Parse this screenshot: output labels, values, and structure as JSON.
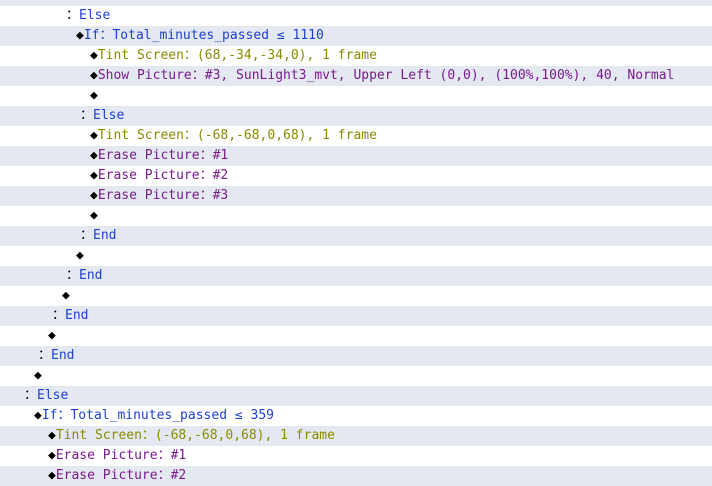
{
  "colors": {
    "row_alt": "#e4e9f1",
    "keyword": "#1f3fd1",
    "tint_screen": "#8a8a00",
    "picture": "#7a1a8f",
    "marker": "#000000"
  },
  "symbols": {
    "diamond": "◆",
    "colon": "："
  },
  "lines": [
    {
      "indent": 80,
      "kind": "diamond",
      "text": ""
    },
    {
      "indent": 66,
      "kind": "branch",
      "text": "Else"
    },
    {
      "indent": 76,
      "kind": "if",
      "text": "If：Total_minutes_passed ≤ 1110"
    },
    {
      "indent": 90,
      "kind": "tint",
      "text": "Tint Screen：(68,-34,-34,0), 1 frame"
    },
    {
      "indent": 90,
      "kind": "pic",
      "text": "Show Picture：#3, SunLight3_mvt, Upper Left (0,0), (100%,100%), 40, Normal"
    },
    {
      "indent": 90,
      "kind": "diamond",
      "text": ""
    },
    {
      "indent": 80,
      "kind": "branch",
      "text": "Else"
    },
    {
      "indent": 90,
      "kind": "tint",
      "text": "Tint Screen：(-68,-68,0,68), 1 frame"
    },
    {
      "indent": 90,
      "kind": "pic",
      "text": "Erase Picture：#1"
    },
    {
      "indent": 90,
      "kind": "pic",
      "text": "Erase Picture：#2"
    },
    {
      "indent": 90,
      "kind": "pic",
      "text": "Erase Picture：#3"
    },
    {
      "indent": 90,
      "kind": "diamond",
      "text": ""
    },
    {
      "indent": 80,
      "kind": "branch",
      "text": "End"
    },
    {
      "indent": 76,
      "kind": "diamond",
      "text": ""
    },
    {
      "indent": 66,
      "kind": "branch",
      "text": "End"
    },
    {
      "indent": 62,
      "kind": "diamond",
      "text": ""
    },
    {
      "indent": 52,
      "kind": "branch",
      "text": "End"
    },
    {
      "indent": 48,
      "kind": "diamond",
      "text": ""
    },
    {
      "indent": 38,
      "kind": "branch",
      "text": "End"
    },
    {
      "indent": 34,
      "kind": "diamond",
      "text": ""
    },
    {
      "indent": 24,
      "kind": "branch",
      "text": "Else"
    },
    {
      "indent": 34,
      "kind": "if",
      "text": "If：Total_minutes_passed ≤ 359"
    },
    {
      "indent": 48,
      "kind": "tint",
      "text": "Tint Screen：(-68,-68,0,68), 1 frame"
    },
    {
      "indent": 48,
      "kind": "pic",
      "text": "Erase Picture：#1"
    },
    {
      "indent": 48,
      "kind": "pic",
      "text": "Erase Picture：#2"
    }
  ]
}
